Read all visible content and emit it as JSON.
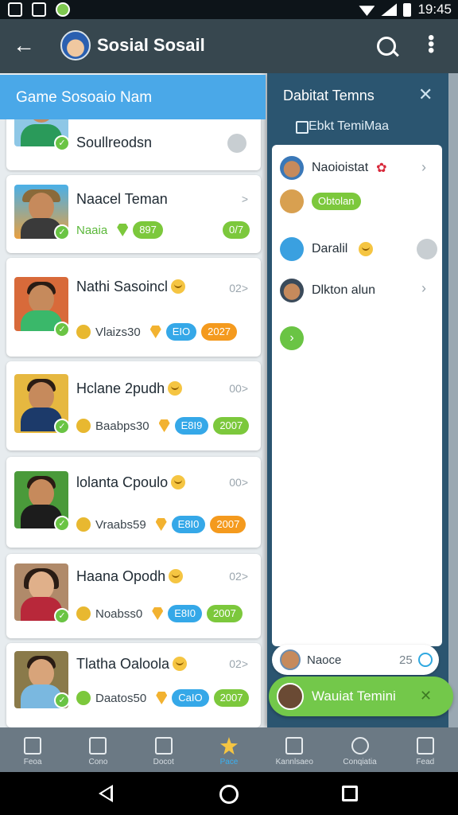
{
  "status_bar": {
    "time": "19:45"
  },
  "app_bar": {
    "title": "Sosial Sosail"
  },
  "left_panel": {
    "header": "Game Sosoaio Nam",
    "cards": [
      {
        "name": "Soullreodsn"
      },
      {
        "name": "Naacel Teman",
        "meta_label": "Naaia",
        "badge_a": "897",
        "badge_b": "0/7"
      },
      {
        "name": "Nathi Sasoincl",
        "count": "02>",
        "meta_label": "Vlaizs30",
        "badge_a": "EIO",
        "badge_b": "2027"
      },
      {
        "name": "Hclane 2pudh",
        "count": "00>",
        "meta_label": "Baabps30",
        "badge_a": "E8I9",
        "badge_b": "2007"
      },
      {
        "name": "lolanta Cpoulo",
        "count": "00>",
        "meta_label": "Vraabs59",
        "badge_a": "E8I0",
        "badge_b": "2007"
      },
      {
        "name": "Haana Opodh",
        "count": "02>",
        "meta_label": "Noabss0",
        "badge_a": "E8I0",
        "badge_b": "2007"
      },
      {
        "name": "Tlatha Oaloola",
        "count": "02>",
        "meta_label": "Daatos50",
        "badge_a": "CaIO",
        "badge_b": "2007"
      }
    ]
  },
  "right_panel": {
    "title": "Dabitat Temns",
    "subtitle": "Ebkt TemiMaa",
    "items": [
      {
        "name": "Naoioistat"
      },
      {
        "name": "Obtolan"
      },
      {
        "name": "Daralil"
      },
      {
        "name": "Dlkton alun"
      }
    ]
  },
  "mini_card": {
    "label": "Naoce",
    "count": "25"
  },
  "fab": {
    "label": "Wauiat Temini"
  },
  "bottom_nav": [
    "Feoa",
    "Cono",
    "Docot",
    "Pace",
    "Kannlsaeo",
    "Conqiatia",
    "Fead"
  ],
  "colors": {
    "accent": "#4aa8e8",
    "green": "#73c84a",
    "orange": "#f49a1e",
    "blue_pill": "#35a8e8"
  }
}
